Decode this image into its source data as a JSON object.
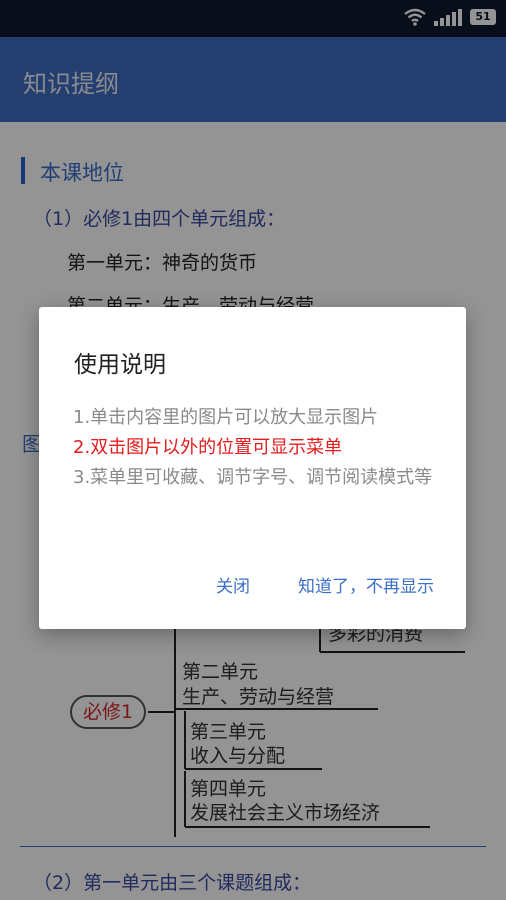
{
  "status_bar": {
    "battery": "51"
  },
  "app_bar": {
    "title": "知识提纲"
  },
  "content": {
    "section_title": "本课地位",
    "line1": "（1）必修1由四个单元组成：",
    "unit1": "第一单元：神奇的货币",
    "unit2": "第二单元：生产、劳动与经营",
    "side_char": "图",
    "diagram": {
      "root": "必修1",
      "branch1_tail": "多彩的消费",
      "branch2": [
        "第二单元",
        "生产、劳动与经营"
      ],
      "branch3": [
        "第三单元",
        "收入与分配"
      ],
      "branch4": [
        "第四单元",
        "发展社会主义市场经济"
      ]
    },
    "line2": "（2）第一单元由三个课题组成："
  },
  "dialog": {
    "title": "使用说明",
    "item1": "1.单击内容里的图片可以放大显示图片",
    "item2": "2.双击图片以外的位置可显示菜单",
    "item3": "3.菜单里可收藏、调节字号、调节阅读模式等",
    "close_label": "关闭",
    "dismiss_label": "知道了，不再显示"
  },
  "colors": {
    "app_bar": "#3f6cc1",
    "accent": "#3c6fc6",
    "highlight": "#e31c1c"
  }
}
